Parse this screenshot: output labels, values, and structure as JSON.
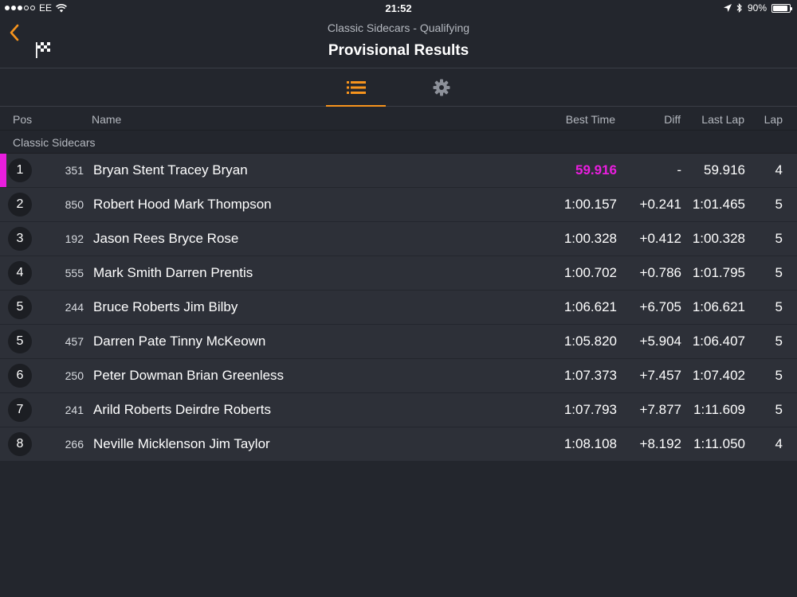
{
  "status": {
    "carrier": "EE",
    "time": "21:52",
    "battery": "90%",
    "battery_level": 0.9
  },
  "header": {
    "subtitle": "Classic Sidecars - Qualifying",
    "title": "Provisional Results"
  },
  "columns": {
    "pos": "Pos",
    "name": "Name",
    "best": "Best Time",
    "diff": "Diff",
    "last": "Last Lap",
    "lap": "Lap"
  },
  "group": "Classic Sidecars",
  "accent_color": "#f7941d",
  "fastest_color": "#e91ede",
  "rows": [
    {
      "pos": "1",
      "num": "351",
      "name": "Bryan Stent Tracey Bryan",
      "best": "59.916",
      "diff": "-",
      "last": "59.916",
      "lap": "4",
      "fastest": true
    },
    {
      "pos": "2",
      "num": "850",
      "name": "Robert Hood Mark Thompson",
      "best": "1:00.157",
      "diff": "+0.241",
      "last": "1:01.465",
      "lap": "5"
    },
    {
      "pos": "3",
      "num": "192",
      "name": "Jason Rees Bryce Rose",
      "best": "1:00.328",
      "diff": "+0.412",
      "last": "1:00.328",
      "lap": "5"
    },
    {
      "pos": "4",
      "num": "555",
      "name": "Mark Smith Darren Prentis",
      "best": "1:00.702",
      "diff": "+0.786",
      "last": "1:01.795",
      "lap": "5"
    },
    {
      "pos": "5",
      "num": "244",
      "name": "Bruce Roberts Jim Bilby",
      "best": "1:06.621",
      "diff": "+6.705",
      "last": "1:06.621",
      "lap": "5"
    },
    {
      "pos": "5",
      "num": "457",
      "name": "Darren Pate Tinny McKeown",
      "best": "1:05.820",
      "diff": "+5.904",
      "last": "1:06.407",
      "lap": "5"
    },
    {
      "pos": "6",
      "num": "250",
      "name": "Peter Dowman Brian Greenless",
      "best": "1:07.373",
      "diff": "+7.457",
      "last": "1:07.402",
      "lap": "5"
    },
    {
      "pos": "7",
      "num": "241",
      "name": "Arild Roberts Deirdre Roberts",
      "best": "1:07.793",
      "diff": "+7.877",
      "last": "1:11.609",
      "lap": "5"
    },
    {
      "pos": "8",
      "num": "266",
      "name": "Neville Micklenson Jim Taylor",
      "best": "1:08.108",
      "diff": "+8.192",
      "last": "1:11.050",
      "lap": "4"
    }
  ]
}
